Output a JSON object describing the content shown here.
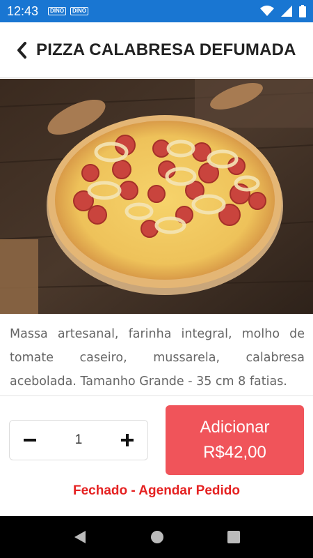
{
  "status_bar": {
    "time": "12:43",
    "notifications": [
      "DINO",
      "DINO"
    ],
    "color": "#1976d2"
  },
  "header": {
    "title": "PIZZA CALABRESA DEFUMADA",
    "back_icon": "chevron-left-icon"
  },
  "product": {
    "image_alt": "pizza-photo",
    "description": "Massa artesanal, farinha integral, molho de tomate caseiro, mussarela, calabresa acebolada. Tamanho Grande - 35 cm 8 fatias."
  },
  "quantity": {
    "value": "1",
    "decrement_icon": "minus-icon",
    "increment_icon": "plus-icon"
  },
  "add_button": {
    "label": "Adicionar",
    "price": "R$42,00",
    "color": "#f0545a"
  },
  "store_status": {
    "text": "Fechado - Agendar Pedido",
    "color": "#e52222"
  },
  "nav_bar": {
    "back": "back-triangle-icon",
    "home": "home-circle-icon",
    "recents": "recents-square-icon"
  }
}
